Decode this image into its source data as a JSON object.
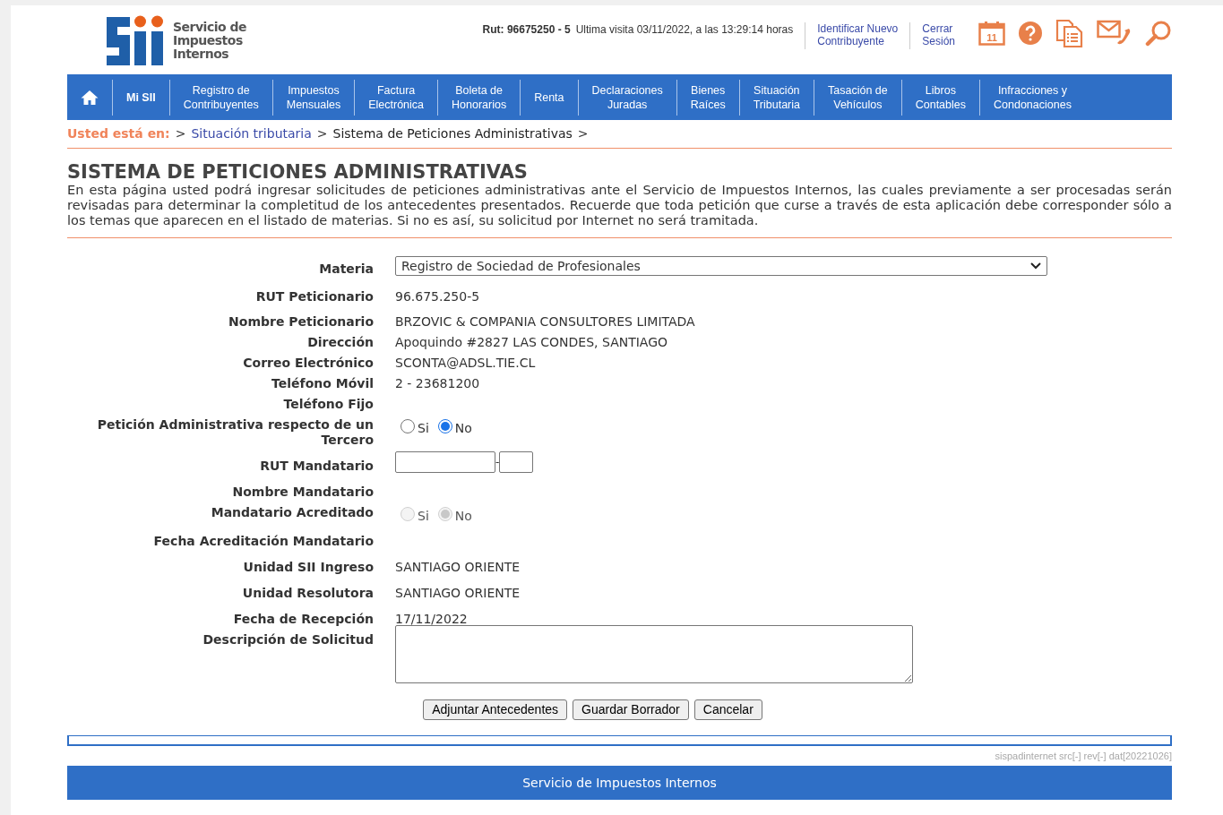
{
  "header": {
    "logo_text": [
      "Servicio de",
      "Impuestos",
      "Internos"
    ],
    "session_info": "Rut: 96675250 - 5",
    "last_visit": "Ultima visita 03/11/2022, a las 13:29:14 horas",
    "links": [
      [
        "Identificar Nuevo",
        "Contribuyente"
      ],
      [
        "Cerrar",
        "Sesión"
      ]
    ],
    "calendar_day": "11"
  },
  "nav": {
    "items": [
      {
        "kind": "home"
      },
      {
        "kind": "text",
        "lines": [
          "Mi SII"
        ]
      },
      {
        "kind": "text",
        "lines": [
          "Registro de",
          "Contribuyentes"
        ]
      },
      {
        "kind": "text",
        "lines": [
          "Impuestos",
          "Mensuales"
        ]
      },
      {
        "kind": "text",
        "lines": [
          "Factura",
          "Electrónica"
        ]
      },
      {
        "kind": "text",
        "lines": [
          "Boleta de",
          "Honorarios"
        ]
      },
      {
        "kind": "text",
        "lines": [
          "Renta"
        ]
      },
      {
        "kind": "text",
        "lines": [
          "Declaraciones",
          "Juradas"
        ]
      },
      {
        "kind": "text",
        "lines": [
          "Bienes",
          "Raíces"
        ]
      },
      {
        "kind": "text",
        "lines": [
          "Situación",
          "Tributaria"
        ]
      },
      {
        "kind": "text",
        "lines": [
          "Tasación de",
          "Vehículos"
        ]
      },
      {
        "kind": "text",
        "lines": [
          "Libros",
          "Contables"
        ]
      },
      {
        "kind": "text",
        "lines": [
          "Infracciones y",
          "Condonaciones"
        ]
      }
    ]
  },
  "breadcrumb": {
    "label": "Usted está en:",
    "items": [
      {
        "text": "Situación tributaria",
        "link": true
      },
      {
        "text": "Sistema de Peticiones Administrativas",
        "link": false
      }
    ],
    "separator": ">"
  },
  "title": "SISTEMA DE PETICIONES ADMINISTRATIVAS",
  "intro": "En esta página usted podrá ingresar solicitudes de peticiones administrativas ante el Servicio de Impuestos Internos, las cuales previamente a ser procesadas serán revisadas para determinar la completitud de los antecedentes presentados. Recuerde que toda petición que curse a través de esta aplicación debe corresponder sólo a los temas que aparecen en el listado de materias. Si no es así, su solicitud por Internet no será tramitada.",
  "form": {
    "rows": [
      {
        "kind": "select",
        "label": "Materia",
        "value": "Registro de Sociedad de Profesionales"
      },
      {
        "kind": "text",
        "label": "RUT Peticionario",
        "value": "96.675.250-5"
      },
      {
        "kind": "text",
        "label": "Nombre Peticionario",
        "value": "BRZOVIC & COMPANIA CONSULTORES LIMITADA"
      },
      {
        "kind": "text",
        "label": "Dirección",
        "value": "Apoquindo #2827 LAS CONDES, SANTIAGO"
      },
      {
        "kind": "text",
        "label": "Correo Electrónico",
        "value": "SCONTA@ADSL.TIE.CL"
      },
      {
        "kind": "text",
        "label": "Teléfono Móvil",
        "value": "2 - 23681200"
      },
      {
        "kind": "text",
        "label": "Teléfono Fijo"
      },
      {
        "kind": "radio",
        "label": "Petición Administrativa respecto de un Tercero",
        "disabled": false,
        "options": [
          {
            "label": "Si",
            "selected": false
          },
          {
            "label": "No",
            "selected": true
          }
        ]
      },
      {
        "kind": "rut",
        "label": "RUT Mandatario",
        "separator": "-"
      },
      {
        "kind": "text",
        "label": "Nombre Mandatario"
      },
      {
        "kind": "radio",
        "label": "Mandatario Acreditado",
        "disabled": true,
        "options": [
          {
            "label": "Si",
            "selected": false
          },
          {
            "label": "No",
            "selected": true
          }
        ]
      },
      {
        "kind": "text",
        "label": "Fecha Acreditación Mandatario"
      },
      {
        "kind": "text",
        "label": "Unidad SII Ingreso",
        "value": "SANTIAGO ORIENTE"
      },
      {
        "kind": "text",
        "label": "Unidad Resolutora",
        "value": "SANTIAGO ORIENTE"
      },
      {
        "kind": "text",
        "label": "Fecha de Recepción",
        "value": "17/11/2022"
      },
      {
        "kind": "textarea",
        "label": "Descripción de Solicitud"
      }
    ]
  },
  "buttons": [
    "Adjuntar Antecedentes",
    "Guardar Borrador",
    "Cancelar"
  ],
  "version": "sispadinternet src[-] rev[-] dat[20221026]",
  "footer": "Servicio de Impuestos Internos"
}
